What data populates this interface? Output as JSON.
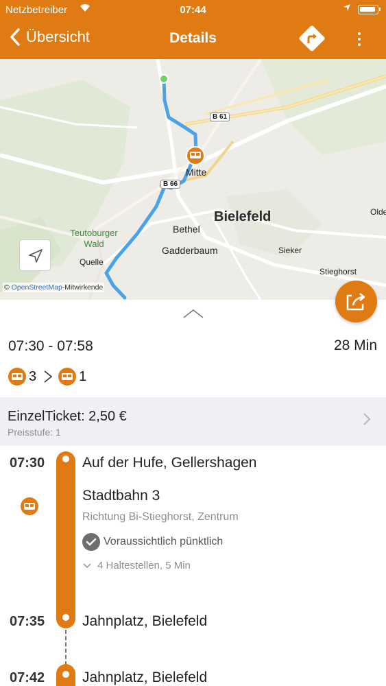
{
  "status_bar": {
    "carrier": "Netzbetreiber",
    "time": "07:44"
  },
  "nav": {
    "back_label": "Übersicht",
    "title": "Details"
  },
  "map": {
    "labels": {
      "b61": "B 61",
      "b66": "B 66",
      "mitte": "Mitte",
      "bielefeld": "Bielefeld",
      "oldentrup": "Olde",
      "teutoburger": "Teutoburger",
      "wald": "Wald",
      "bethel": "Bethel",
      "gadderbaum": "Gadderbaum",
      "sieker": "Sieker",
      "stieghorst": "Stieghorst",
      "quelle": "Quelle"
    },
    "attribution_prefix": "© ",
    "attribution_link": "OpenStreetMap",
    "attribution_suffix": "-Mitwirkende",
    "route_color": "#4aa3e8"
  },
  "summary": {
    "time_range": "07:30 - 07:58",
    "duration": "28 Min",
    "transfers": [
      {
        "mode": "tram-icon",
        "line": "3"
      },
      {
        "mode": "tram-icon",
        "line": "1"
      }
    ]
  },
  "ticket": {
    "title": "EinzelTicket: 2,50 €",
    "subtitle": "Preisstufe: 1"
  },
  "itinerary": {
    "departure_time": "07:30",
    "departure_stop": "Auf der Hufe, Gellershagen",
    "line_name": "Stadtbahn 3",
    "direction": "Richtung Bi-Stieghorst, Zentrum",
    "punctuality": "Voraussichtlich pünktlich",
    "stops_info": "4 Haltestellen, 5 Min",
    "arrival_time": "07:35",
    "arrival_stop": "Jahnplatz, Bielefeld",
    "next_time": "07:42",
    "next_stop": "Jahnplatz, Bielefeld"
  },
  "colors": {
    "accent": "#e07b13",
    "ticket_bg": "#efeff4"
  }
}
